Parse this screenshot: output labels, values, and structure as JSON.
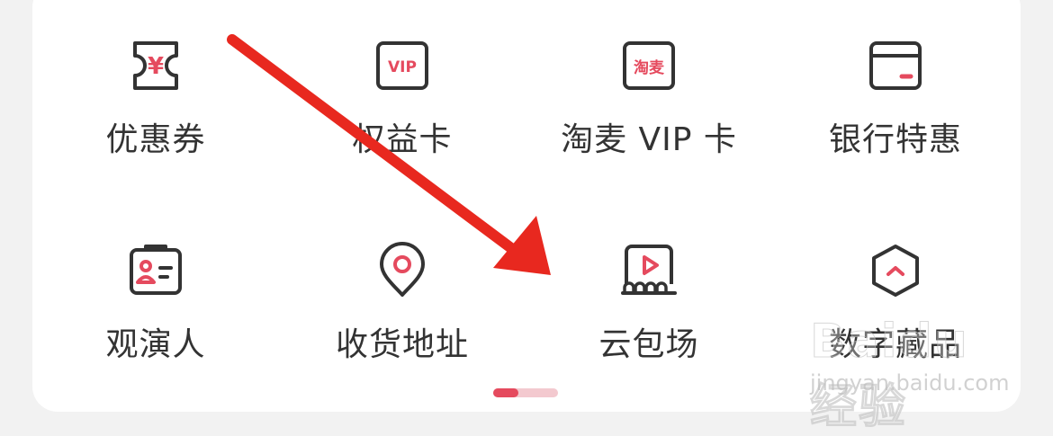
{
  "colors": {
    "accent": "#e54a5e",
    "icon_stroke": "#333333",
    "background": "#f2f2f2",
    "card": "#ffffff",
    "arrow": "#e8281f"
  },
  "row1": [
    {
      "label": "优惠券",
      "icon": "coupon-icon"
    },
    {
      "label": "权益卡",
      "icon": "vip-card-icon",
      "icon_text": "VIP"
    },
    {
      "label": "淘麦 VIP 卡",
      "icon": "taomai-icon",
      "icon_text": "淘麦"
    },
    {
      "label": "银行特惠",
      "icon": "bank-card-icon"
    }
  ],
  "row2": [
    {
      "label": "观演人",
      "icon": "id-card-icon"
    },
    {
      "label": "收货地址",
      "icon": "location-pin-icon"
    },
    {
      "label": "云包场",
      "icon": "cinema-play-icon"
    },
    {
      "label": "数字藏品",
      "icon": "hexagon-icon"
    }
  ],
  "pager": {
    "pages": 2,
    "current": 1
  },
  "coupon_symbol": "¥",
  "watermark": {
    "main": "Baidu经验",
    "sub": "jingyan.baidu.com"
  }
}
